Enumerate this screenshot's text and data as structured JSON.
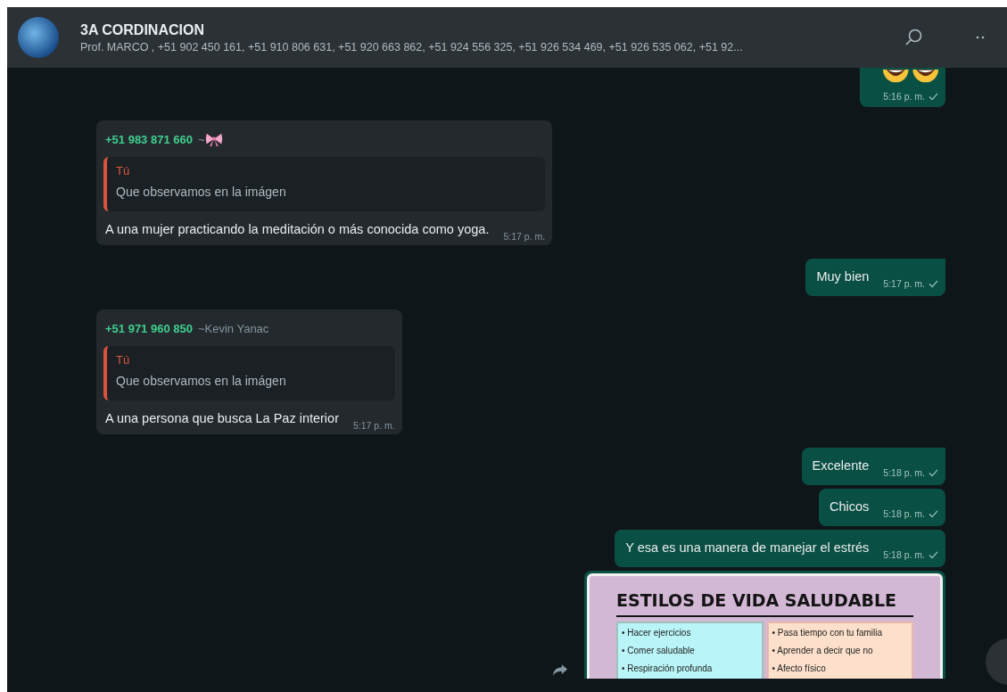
{
  "header": {
    "title": "3A CORDINACION",
    "subtitle": "Prof. MARCO , +51 902 450 161, +51 910 806 631, +51 920 663 862, +51 924 556 325, +51 926 534 469, +51 926 535 062, +51 92..."
  },
  "messages": [
    {
      "kind": "emoji",
      "tail": true,
      "time": "5:16 p. m.",
      "sent": true
    },
    {
      "kind": "incoming",
      "sender_phone": "+51 983 871 660",
      "sender_name": "~",
      "name_emoji": true,
      "quote": {
        "author": "Tú",
        "text": "Que observamos en la imágen"
      },
      "text": "A una mujer practicando la meditación o más conocida como yoga.",
      "time": "5:17 p. m."
    },
    {
      "kind": "outgoing",
      "tail": true,
      "text": "Muy bien",
      "time": "5:17 p. m.",
      "sent": true
    },
    {
      "kind": "incoming",
      "sender_phone": "+51 971 960 850",
      "sender_name": "~Kevin Yanac",
      "name_emoji": false,
      "quote": {
        "author": "Tú",
        "text": "Que observamos en la imágen"
      },
      "text": "A una persona que busca La Paz interior",
      "time": "5:17 p. m."
    },
    {
      "kind": "outgoing",
      "tail": true,
      "text": "Excelente",
      "time": "5:18 p. m.",
      "sent": true
    },
    {
      "kind": "outgoing",
      "tail": false,
      "text": "Chicos",
      "time": "5:18 p. m.",
      "sent": true
    },
    {
      "kind": "outgoing",
      "tail": false,
      "text": "Y esa es una manera de manejar el estrés",
      "time": "5:18 p. m.",
      "sent": true
    },
    {
      "kind": "image",
      "slide": {
        "title": "ESTILOS DE VIDA SALUDABLE",
        "left": [
          "• Hacer ejercicios",
          "• Comer saludable",
          "• Respiración profunda"
        ],
        "right": [
          "• Pasa tiempo con tu familia",
          "• Aprender a decir que no",
          "• Afecto físico"
        ]
      }
    }
  ]
}
